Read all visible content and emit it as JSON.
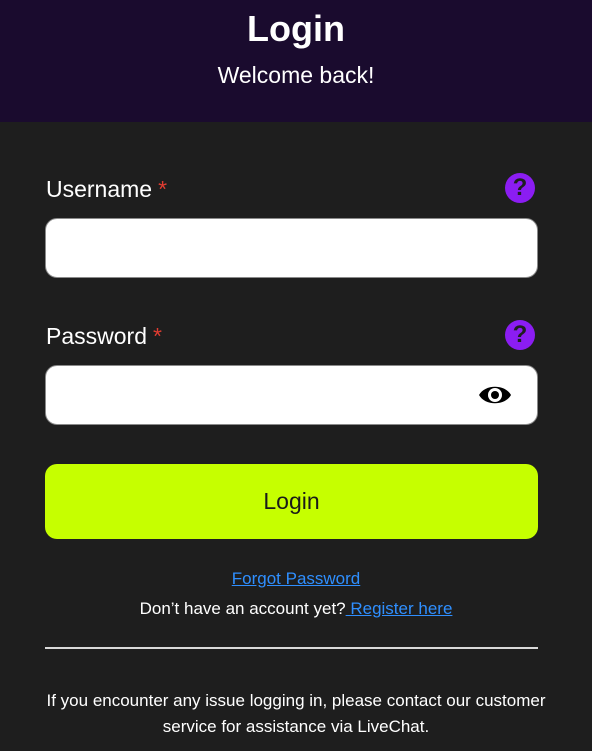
{
  "header": {
    "title": "Login",
    "subtitle": "Welcome back!"
  },
  "form": {
    "username": {
      "label": "Username",
      "required_marker": "*",
      "value": "",
      "help_icon": "question-circle-icon"
    },
    "password": {
      "label": "Password",
      "required_marker": "*",
      "value": "",
      "help_icon": "question-circle-icon",
      "toggle_icon": "eye-icon"
    },
    "submit_label": "Login"
  },
  "links": {
    "forgot_password": "Forgot Password",
    "no_account_text": "Don’t have an account yet?",
    "register": " Register here"
  },
  "notice": "If you encounter any issue logging in, please contact our customer service for assistance via LiveChat.",
  "colors": {
    "header_bg": "#1a0b2e",
    "body_bg": "#1e1e1e",
    "accent_button": "#c6ff00",
    "help_icon": "#8b1df2",
    "link": "#2f8fff",
    "required": "#e03c31"
  }
}
